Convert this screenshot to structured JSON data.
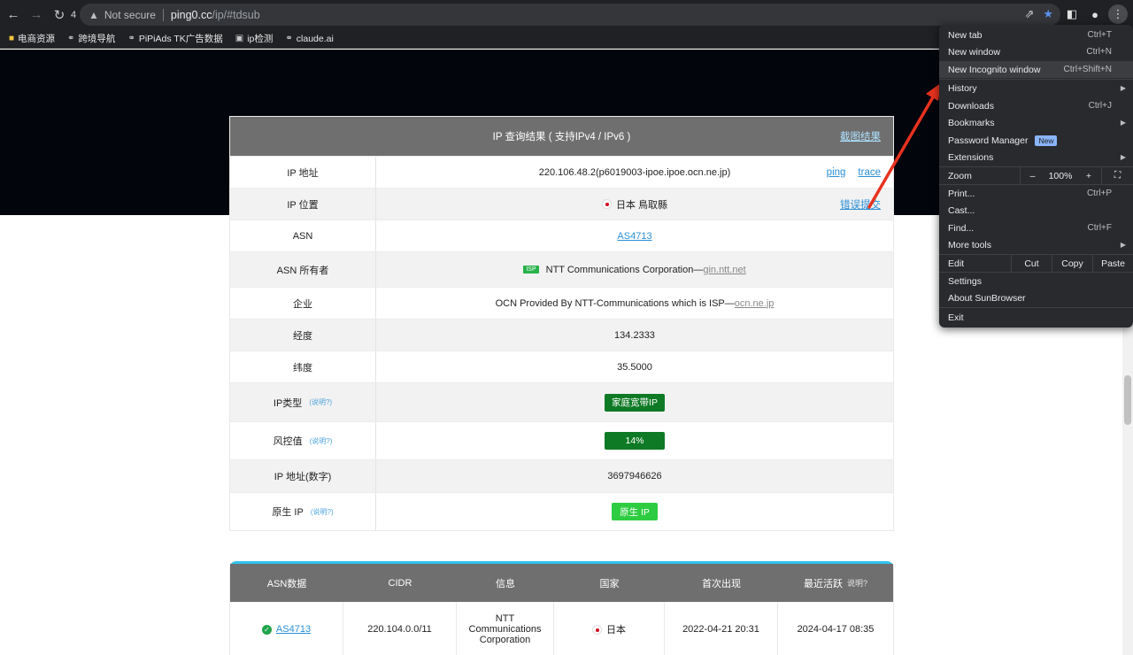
{
  "browser": {
    "tab_count": "4",
    "security_label": "Not secure",
    "url_host": "ping0.cc",
    "url_rest": "/ip/#tdsub",
    "bookmarks": [
      {
        "label": "电商资源",
        "icon": "folder-icon"
      },
      {
        "label": "跨境导航",
        "icon": "globe-icon"
      },
      {
        "label": "PiPiAds TK广告数据",
        "icon": "globe-icon"
      },
      {
        "label": "ip检测",
        "icon": "monitor-icon"
      },
      {
        "label": "claude.ai",
        "icon": "globe-icon"
      }
    ]
  },
  "ip_card": {
    "header_title": "IP 查询结果 ( 支持IPv4 / IPv6 )",
    "screenshot_link": "截图结果",
    "explain_label": "(说明?)",
    "rows": {
      "ip_label": "IP 地址",
      "ip_value": "220.106.48.2(p6019003-ipoe.ipoe.ocn.ne.jp)",
      "ping_link": "ping",
      "trace_link": "trace",
      "location_label": "IP 位置",
      "location_value": "日本 鳥取縣",
      "error_link": "错误提交",
      "asn_label": "ASN",
      "asn_value": "AS4713",
      "asn_owner_label": "ASN 所有者",
      "isp_badge": "ISP",
      "asn_owner_value": "NTT Communications Corporation—",
      "asn_owner_domain": "gin.ntt.net",
      "company_label": "企业",
      "company_value": "OCN Provided By NTT-Communications which is ISP—",
      "company_domain": "ocn.ne.jp",
      "longitude_label": "经度",
      "longitude_value": "134.2333",
      "latitude_label": "纬度",
      "latitude_value": "35.5000",
      "iptype_label": "IP类型",
      "iptype_value": "家庭宽带IP",
      "risk_label": "风控值",
      "risk_value": "14%",
      "ipnum_label": "IP 地址(数字)",
      "ipnum_value": "3697946626",
      "native_label": "原生 IP",
      "native_value": "原生 IP"
    }
  },
  "asn_table": {
    "headers": [
      "ASN数据",
      "CIDR",
      "信息",
      "国家",
      "首次出现",
      "最近活跃"
    ],
    "header_explain": "说明?",
    "row": {
      "asn": "AS4713",
      "cidr": "220.104.0.0/11",
      "info": "NTT Communications Corporation",
      "country": "日本",
      "first_seen": "2022-04-21 20:31",
      "last_active": "2024-04-17 08:35"
    }
  },
  "menu": {
    "new_tab": "New tab",
    "new_tab_sc": "Ctrl+T",
    "new_window": "New window",
    "new_window_sc": "Ctrl+N",
    "new_incognito": "New Incognito window",
    "new_incognito_sc": "Ctrl+Shift+N",
    "history": "History",
    "downloads": "Downloads",
    "downloads_sc": "Ctrl+J",
    "bookmarks": "Bookmarks",
    "password_manager": "Password Manager",
    "new_badge": "New",
    "extensions": "Extensions",
    "zoom": "Zoom",
    "zoom_minus": "–",
    "zoom_level": "100%",
    "zoom_plus": "+",
    "print": "Print...",
    "print_sc": "Ctrl+P",
    "cast": "Cast...",
    "find": "Find...",
    "find_sc": "Ctrl+F",
    "more_tools": "More tools",
    "edit": "Edit",
    "cut": "Cut",
    "copy": "Copy",
    "paste": "Paste",
    "settings": "Settings",
    "about": "About SunBrowser",
    "exit": "Exit"
  },
  "colors": {
    "arrow": "#e8321e",
    "badge_dark_green": "#0f7a25",
    "badge_bright_green": "#2ecc40",
    "accent_blue": "#2ec4ee"
  }
}
